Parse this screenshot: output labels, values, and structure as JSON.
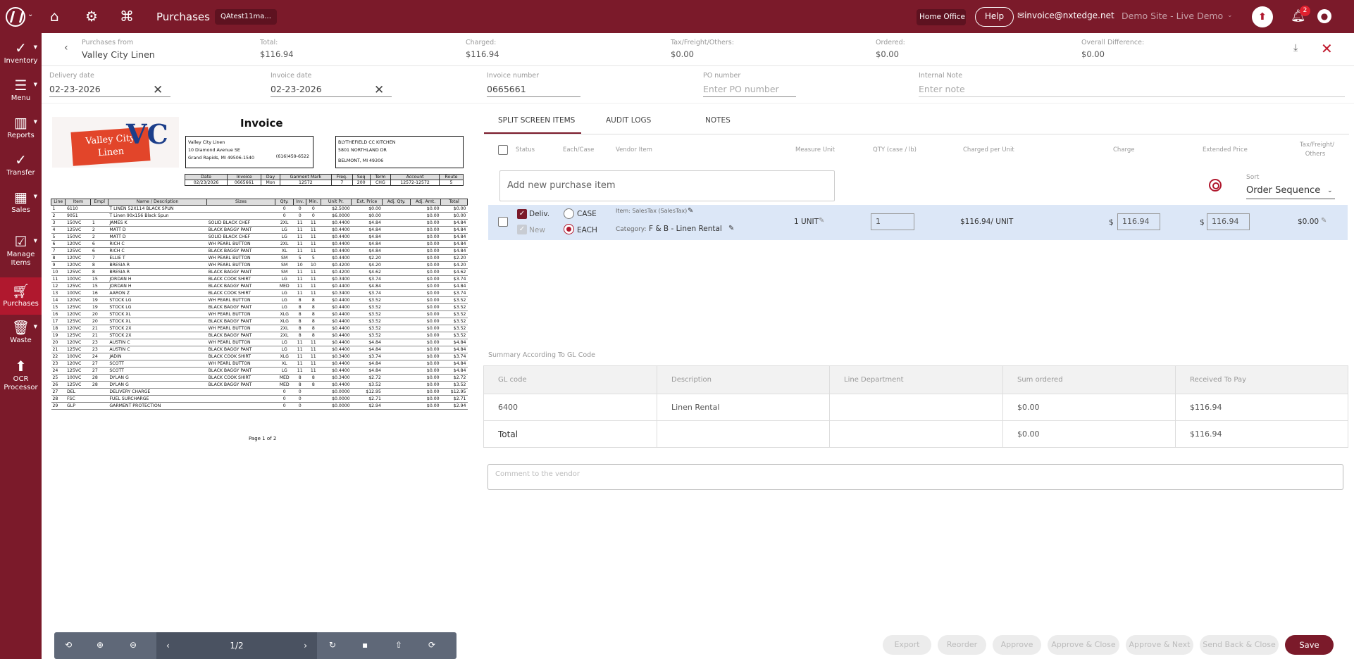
{
  "topbar": {
    "title": "Purchases",
    "chip": "QAtest11ma...",
    "home_office": "Home Office",
    "help": "Help",
    "email": "invoice@nxtedge.net",
    "site": "Demo Site - Live Demo",
    "notification_count": "2"
  },
  "sidebar": {
    "items": [
      {
        "label": "Inventory"
      },
      {
        "label": "Menu"
      },
      {
        "label": "Reports"
      },
      {
        "label": "Transfer"
      },
      {
        "label": "Sales"
      },
      {
        "label": "Manage Items"
      },
      {
        "label": "Purchases"
      },
      {
        "label": "Waste"
      },
      {
        "label": "OCR Processor"
      }
    ]
  },
  "header": {
    "purchases_from_label": "Purchases from",
    "purchases_from": "Valley City Linen",
    "total_label": "Total:",
    "total": "$116.94",
    "charged_label": "Charged:",
    "charged": "$116.94",
    "tax_label": "Tax/Freight/Others:",
    "tax": "$0.00",
    "ordered_label": "Ordered:",
    "ordered": "$0.00",
    "diff_label": "Overall Difference:",
    "diff": "$0.00"
  },
  "fields": {
    "delivery_date_label": "Delivery date",
    "delivery_date": "02-23-2026",
    "invoice_date_label": "Invoice date",
    "invoice_date": "02-23-2026",
    "invoice_number_label": "Invoice number",
    "invoice_number": "0665661",
    "po_number_label": "PO number",
    "po_number_placeholder": "Enter PO number",
    "internal_note_label": "Internal Note",
    "internal_note_placeholder": "Enter note"
  },
  "invoice_doc": {
    "title": "Invoice",
    "logo_text": "Valley City Linen",
    "logo_mark": "VC",
    "vendor_name": "Valley City Linen",
    "vendor_addr1": "10 Diamond Avenue SE",
    "vendor_city": "Grand Rapids, MI 49506-1540",
    "vendor_phone": "(616)459-6522",
    "ship_name": "BLYTHEFIELD CC KITCHEN",
    "ship_addr": "5801 NORTHLAND DR",
    "ship_city": "BELMONT, MI 49306",
    "meta_headers": [
      "Date",
      "Invoice",
      "Day",
      "Garment Mark",
      "Freq.",
      "Seq",
      "Term",
      "Account",
      "Route"
    ],
    "meta_values": [
      "02/23/2026",
      "0665661",
      "Mon",
      "12572",
      "7",
      "200",
      "CHG",
      "12572-12572",
      "5"
    ],
    "line_headers": [
      "Line",
      "Item",
      "Empl",
      "Name / Description",
      "Sizes",
      "Qty.",
      "Inv.",
      "Min.",
      "Unit Pr.",
      "Ext. Price",
      "Adj. Qty.",
      "Adj. Amt.",
      "Total"
    ],
    "lines": [
      [
        "1",
        "6110",
        "",
        "T LINEN 52X114 BLACK SPUN",
        "",
        "0",
        "0",
        "0",
        "$2.5000",
        "$0.00",
        "",
        "$0.00",
        "$0.00"
      ],
      [
        "2",
        "9051",
        "",
        "T Linen 90x156 Black Spun",
        "",
        "0",
        "0",
        "0",
        "$6.0000",
        "$0.00",
        "",
        "$0.00",
        "$0.00"
      ],
      [
        "3",
        "150VC",
        "1",
        "JAMES K",
        "SOLID BLACK CHEF",
        "2XL",
        "11",
        "11",
        "$0.4400",
        "$4.84",
        "",
        "$0.00",
        "$4.84"
      ],
      [
        "4",
        "125VC",
        "2",
        "MATT D",
        "BLACK BAGGY PANT",
        "LG",
        "11",
        "11",
        "$0.4400",
        "$4.84",
        "",
        "$0.00",
        "$4.84"
      ],
      [
        "5",
        "150VC",
        "2",
        "MATT D",
        "SOLID BLACK CHEF",
        "LG",
        "11",
        "11",
        "$0.4400",
        "$4.84",
        "",
        "$0.00",
        "$4.84"
      ],
      [
        "6",
        "120VC",
        "6",
        "RICH C",
        "WH PEARL BUTTON",
        "2XL",
        "11",
        "11",
        "$0.4400",
        "$4.84",
        "",
        "$0.00",
        "$4.84"
      ],
      [
        "7",
        "125VC",
        "6",
        "RICH C",
        "BLACK BAGGY PANT",
        "XL",
        "11",
        "11",
        "$0.4400",
        "$4.84",
        "",
        "$0.00",
        "$4.84"
      ],
      [
        "8",
        "120VC",
        "7",
        "ELLIE T",
        "WH PEARL BUTTON",
        "SM",
        "5",
        "5",
        "$0.4400",
        "$2.20",
        "",
        "$0.00",
        "$2.20"
      ],
      [
        "9",
        "120VC",
        "8",
        "BRESIA R",
        "WH PEARL BUTTON",
        "SM",
        "10",
        "10",
        "$0.4200",
        "$4.20",
        "",
        "$0.00",
        "$4.20"
      ],
      [
        "10",
        "125VC",
        "8",
        "BRESIA R",
        "BLACK BAGGY PANT",
        "SM",
        "11",
        "11",
        "$0.4200",
        "$4.62",
        "",
        "$0.00",
        "$4.62"
      ],
      [
        "11",
        "100VC",
        "15",
        "JORDAN H",
        "BLACK COOK SHIRT",
        "LG",
        "11",
        "11",
        "$0.3400",
        "$3.74",
        "",
        "$0.00",
        "$3.74"
      ],
      [
        "12",
        "125VC",
        "15",
        "JORDAN H",
        "BLACK BAGGY PANT",
        "MED",
        "11",
        "11",
        "$0.4400",
        "$4.84",
        "",
        "$0.00",
        "$4.84"
      ],
      [
        "13",
        "100VC",
        "16",
        "AARON Z",
        "BLACK COOK SHIRT",
        "LG",
        "11",
        "11",
        "$0.3400",
        "$3.74",
        "",
        "$0.00",
        "$3.74"
      ],
      [
        "14",
        "120VC",
        "19",
        "STOCK LG",
        "WH PEARL BUTTON",
        "LG",
        "8",
        "8",
        "$0.4400",
        "$3.52",
        "",
        "$0.00",
        "$3.52"
      ],
      [
        "15",
        "125VC",
        "19",
        "STOCK LG",
        "BLACK BAGGY PANT",
        "LG",
        "8",
        "8",
        "$0.4400",
        "$3.52",
        "",
        "$0.00",
        "$3.52"
      ],
      [
        "16",
        "120VC",
        "20",
        "STOCK XL",
        "WH PEARL BUTTON",
        "XLG",
        "8",
        "8",
        "$0.4400",
        "$3.52",
        "",
        "$0.00",
        "$3.52"
      ],
      [
        "17",
        "125VC",
        "20",
        "STOCK XL",
        "BLACK BAGGY PANT",
        "XLG",
        "8",
        "8",
        "$0.4400",
        "$3.52",
        "",
        "$0.00",
        "$3.52"
      ],
      [
        "18",
        "120VC",
        "21",
        "STOCK 2X",
        "WH PEARL BUTTON",
        "2XL",
        "8",
        "8",
        "$0.4400",
        "$3.52",
        "",
        "$0.00",
        "$3.52"
      ],
      [
        "19",
        "125VC",
        "21",
        "STOCK 2X",
        "BLACK BAGGY PANT",
        "2XL",
        "8",
        "8",
        "$0.4400",
        "$3.52",
        "",
        "$0.00",
        "$3.52"
      ],
      [
        "20",
        "120VC",
        "23",
        "AUSTIN C",
        "WH PEARL BUTTON",
        "LG",
        "11",
        "11",
        "$0.4400",
        "$4.84",
        "",
        "$0.00",
        "$4.84"
      ],
      [
        "21",
        "125VC",
        "23",
        "AUSTIN C",
        "BLACK BAGGY PANT",
        "LG",
        "11",
        "11",
        "$0.4400",
        "$4.84",
        "",
        "$0.00",
        "$4.84"
      ],
      [
        "22",
        "100VC",
        "24",
        "JADIN",
        "BLACK COOK SHIRT",
        "XLG",
        "11",
        "11",
        "$0.3400",
        "$3.74",
        "",
        "$0.00",
        "$3.74"
      ],
      [
        "23",
        "120VC",
        "27",
        "SCOTT",
        "WH PEARL BUTTON",
        "XL",
        "11",
        "11",
        "$0.4400",
        "$4.84",
        "",
        "$0.00",
        "$4.84"
      ],
      [
        "24",
        "125VC",
        "27",
        "SCOTT",
        "BLACK BAGGY PANT",
        "LG",
        "11",
        "11",
        "$0.4400",
        "$4.84",
        "",
        "$0.00",
        "$4.84"
      ],
      [
        "25",
        "100VC",
        "28",
        "DYLAN G",
        "BLACK COOK SHIRT",
        "MED",
        "8",
        "8",
        "$0.3400",
        "$2.72",
        "",
        "$0.00",
        "$2.72"
      ],
      [
        "26",
        "125VC",
        "28",
        "DYLAN G",
        "BLACK BAGGY PANT",
        "MED",
        "8",
        "8",
        "$0.4400",
        "$3.52",
        "",
        "$0.00",
        "$3.52"
      ],
      [
        "27",
        "DEL",
        "",
        "DELIVERY CHARGE",
        "",
        "0",
        "0",
        "",
        "$0.0000",
        "$12.95",
        "",
        "$0.00",
        "$12.95"
      ],
      [
        "28",
        "FSC",
        "",
        "FUEL SURCHARGE",
        "",
        "0",
        "0",
        "",
        "$0.0000",
        "$2.71",
        "",
        "$0.00",
        "$2.71"
      ],
      [
        "29",
        "GLP",
        "",
        "GARMENT PROTECTION",
        "",
        "0",
        "0",
        "",
        "$0.0000",
        "$2.94",
        "",
        "$0.00",
        "$2.94"
      ]
    ],
    "page_label": "Page 1 of 2"
  },
  "pdf_toolbar": {
    "page": "1/2"
  },
  "tabs": [
    "SPLIT SCREEN ITEMS",
    "AUDIT LOGS",
    "NOTES"
  ],
  "columns": [
    "Status",
    "Each/Case",
    "Vendor Item",
    "Measure Unit",
    "QTY (case / lb)",
    "Charged per Unit",
    "Charge",
    "Extended Price",
    "Tax/Freight/ Others"
  ],
  "add_item_placeholder": "Add new purchase item",
  "sort": {
    "label": "Sort",
    "value": "Order Sequence"
  },
  "item": {
    "deliv": "Deliv.",
    "new": "New",
    "case": "CASE",
    "each": "EACH",
    "item_label": "Item: SalesTax (SalesTax)",
    "category_label": "Category:",
    "category": "F & B - Linen Rental",
    "measure_unit": "1 UNIT",
    "qty": "1",
    "charged_per_unit": "$116.94/ UNIT",
    "currency": "$",
    "charge": "116.94",
    "extended": "116.94",
    "tax": "$0.00"
  },
  "summary": {
    "title": "Summary According To GL Code",
    "headers": [
      "GL code",
      "Description",
      "Line Department",
      "Sum ordered",
      "Received To Pay"
    ],
    "rows": [
      [
        "6400",
        "Linen Rental",
        "",
        "$0.00",
        "$116.94"
      ],
      [
        "Total",
        "",
        "",
        "$0.00",
        "$116.94"
      ]
    ]
  },
  "comment_placeholder": "Comment to the vendor",
  "actions": [
    "Export",
    "Reorder",
    "Approve",
    "Approve & Close",
    "Approve & Next",
    "Send Back & Close",
    "Save"
  ]
}
